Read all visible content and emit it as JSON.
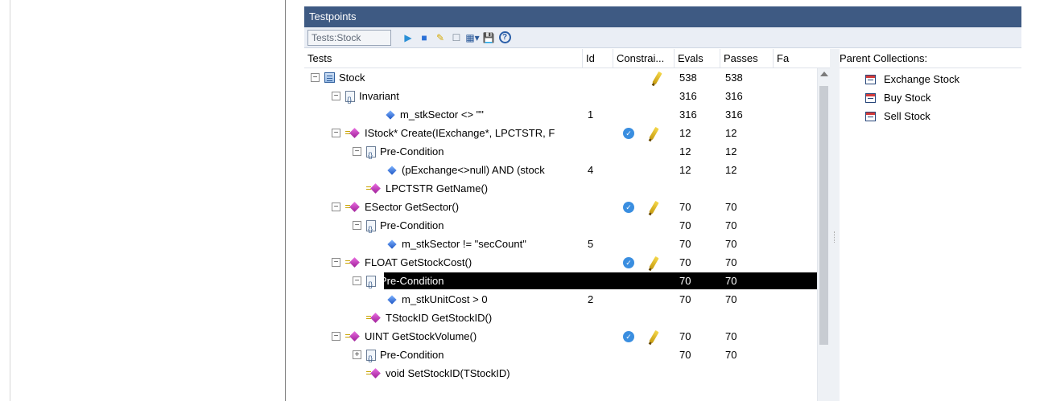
{
  "window": {
    "title": "Testpoints"
  },
  "toolbar": {
    "combo_value": "Tests:Stock",
    "buttons": [
      {
        "name": "run-button",
        "glyph": "▶",
        "color": "#2a8fd6"
      },
      {
        "name": "stop-button",
        "glyph": "■",
        "color": "#2a6fd6"
      },
      {
        "name": "edit-button",
        "glyph": "✎",
        "color": "#d4a800"
      },
      {
        "name": "new-button",
        "glyph": "☐",
        "color": "#7a8796"
      },
      {
        "name": "view-dropdown-button",
        "glyph": "▦▾",
        "color": "#2c5a9a"
      },
      {
        "name": "save-button",
        "glyph": "💾",
        "color": "#1e3c7a"
      },
      {
        "name": "help-button",
        "glyph": "?",
        "color": "#2a5ea8"
      }
    ]
  },
  "grid": {
    "columns": {
      "tests": "Tests",
      "id": "Id",
      "constraints": "Constrai...",
      "evals": "Evals",
      "passes": "Passes",
      "fa": "Fa"
    },
    "rows": [
      {
        "label": "Stock",
        "indent": 0,
        "expander": "⊟",
        "icon": "class",
        "id": "",
        "check": false,
        "pencil": true,
        "evals": "538",
        "passes": "538"
      },
      {
        "label": "Invariant",
        "indent": 1,
        "expander": "⊟",
        "icon": "constraint",
        "id": "",
        "check": false,
        "pencil": false,
        "evals": "316",
        "passes": "316"
      },
      {
        "label": "m_stkSector <> \"\"",
        "indent": 3,
        "expander": "",
        "icon": "attr",
        "id": "1",
        "check": false,
        "pencil": false,
        "evals": "316",
        "passes": "316"
      },
      {
        "label": "IStock* Create(IExchange*, LPCTSTR, F",
        "indent": 1,
        "expander": "⊟",
        "icon": "op",
        "id": "",
        "check": true,
        "pencil": true,
        "evals": "12",
        "passes": "12"
      },
      {
        "label": "Pre-Condition",
        "indent": 2,
        "expander": "⊟",
        "icon": "constraint",
        "id": "",
        "check": false,
        "pencil": false,
        "evals": "12",
        "passes": "12"
      },
      {
        "label": "(pExchange<>null) AND (stock",
        "indent": 4,
        "expander": "",
        "icon": "attr",
        "id": "4",
        "check": false,
        "pencil": false,
        "evals": "12",
        "passes": "12"
      },
      {
        "label": "LPCTSTR GetName()",
        "indent": 2,
        "expander": "",
        "icon": "op",
        "id": "",
        "check": false,
        "pencil": false,
        "evals": "",
        "passes": ""
      },
      {
        "label": "ESector GetSector()",
        "indent": 1,
        "expander": "⊟",
        "icon": "op",
        "id": "",
        "check": true,
        "pencil": true,
        "evals": "70",
        "passes": "70"
      },
      {
        "label": "Pre-Condition",
        "indent": 2,
        "expander": "⊟",
        "icon": "constraint",
        "id": "",
        "check": false,
        "pencil": false,
        "evals": "70",
        "passes": "70"
      },
      {
        "label": "m_stkSector != \"secCount\"",
        "indent": 4,
        "expander": "",
        "icon": "attr",
        "id": "5",
        "check": false,
        "pencil": false,
        "evals": "70",
        "passes": "70"
      },
      {
        "label": "FLOAT GetStockCost()",
        "indent": 1,
        "expander": "⊟",
        "icon": "op",
        "id": "",
        "check": true,
        "pencil": true,
        "evals": "70",
        "passes": "70"
      },
      {
        "label": "Pre-Condition",
        "indent": 2,
        "expander": "⊟",
        "icon": "constraint",
        "id": "",
        "check": false,
        "pencil": false,
        "evals": "70",
        "passes": "70",
        "selected": true
      },
      {
        "label": "m_stkUnitCost > 0",
        "indent": 4,
        "expander": "",
        "icon": "attr",
        "id": "2",
        "check": false,
        "pencil": false,
        "evals": "70",
        "passes": "70"
      },
      {
        "label": "TStockID GetStockID()",
        "indent": 2,
        "expander": "",
        "icon": "op",
        "id": "",
        "check": false,
        "pencil": false,
        "evals": "",
        "passes": ""
      },
      {
        "label": "UINT GetStockVolume()",
        "indent": 1,
        "expander": "⊟",
        "icon": "op",
        "id": "",
        "check": true,
        "pencil": true,
        "evals": "70",
        "passes": "70"
      },
      {
        "label": "Pre-Condition",
        "indent": 2,
        "expander": "⊞",
        "icon": "constraint",
        "id": "",
        "check": false,
        "pencil": false,
        "evals": "70",
        "passes": "70"
      },
      {
        "label": "void SetStockID(TStockID)",
        "indent": 2,
        "expander": "",
        "icon": "op",
        "id": "",
        "check": false,
        "pencil": false,
        "evals": "",
        "passes": ""
      }
    ]
  },
  "parents": {
    "header": "Parent Collections:",
    "items": [
      "Exchange Stock",
      "Buy Stock",
      "Sell Stock"
    ]
  }
}
